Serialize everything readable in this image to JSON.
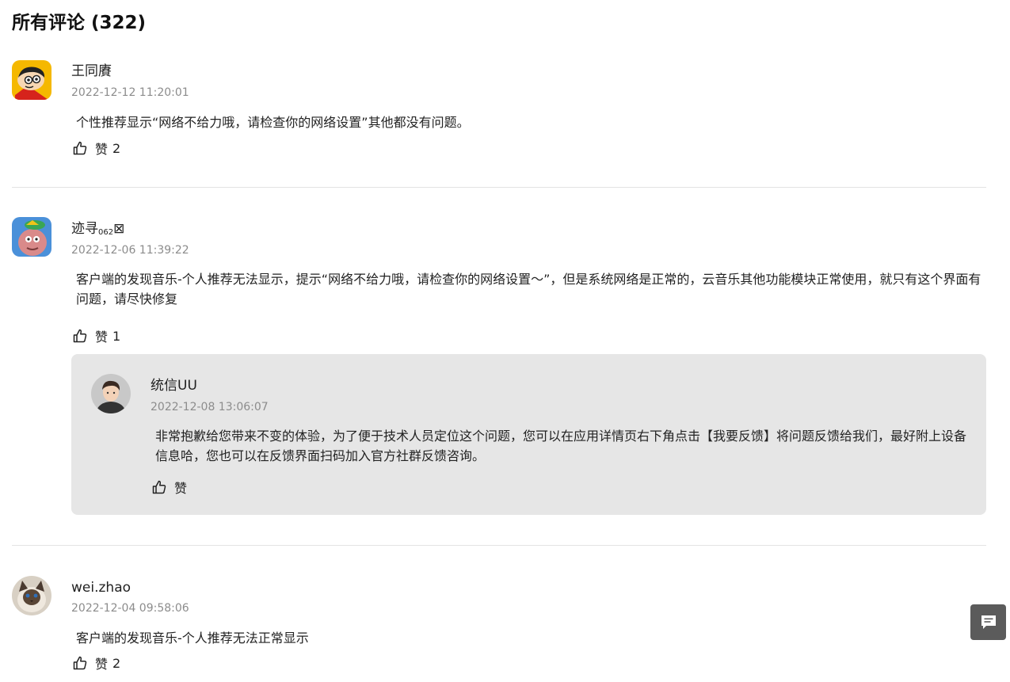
{
  "heading": "所有评论 (322)",
  "like_icon": "thumbs-up-icon",
  "feedback_icon": "message-icon",
  "comments": [
    {
      "author": "王同賡",
      "time": "2022-12-12 11:20:01",
      "text": "个性推荐显示“网络不给力哦，请检查你的网络设置”其他都没有问题。",
      "like_label": "赞",
      "like_count": "2",
      "avatar_icon": "crayon-shinchan-avatar"
    },
    {
      "author": "迹寻",
      "author_sub": "062",
      "author_glyph": "⊠",
      "time": "2022-12-06 11:39:22",
      "text": "客户端的发现音乐-个人推荐无法显示，提示“网络不给力哦，请检查你的网络设置～”，但是系统网络是正常的，云音乐其他功能模块正常使用，就只有这个界面有问题，请尽快修复",
      "like_label": "赞",
      "like_count": "1",
      "avatar_icon": "cartoon-creature-avatar",
      "reply": {
        "author": "统信UU",
        "time": "2022-12-08 13:06:07",
        "text": "非常抱歉给您带来不变的体验，为了便于技术人员定位这个问题，您可以在应用详情页右下角点击【我要反馈】将问题反馈给我们，最好附上设备信息哈，您也可以在反馈界面扫码加入官方社群反馈咨询。",
        "like_label": "赞",
        "avatar_icon": "default-user-avatar"
      }
    },
    {
      "author": "wei.zhao",
      "time": "2022-12-04 09:58:06",
      "text": "客户端的发现音乐-个人推荐无法正常显示",
      "like_label": "赞",
      "like_count": "2",
      "avatar_icon": "cat-photo-avatar"
    }
  ]
}
